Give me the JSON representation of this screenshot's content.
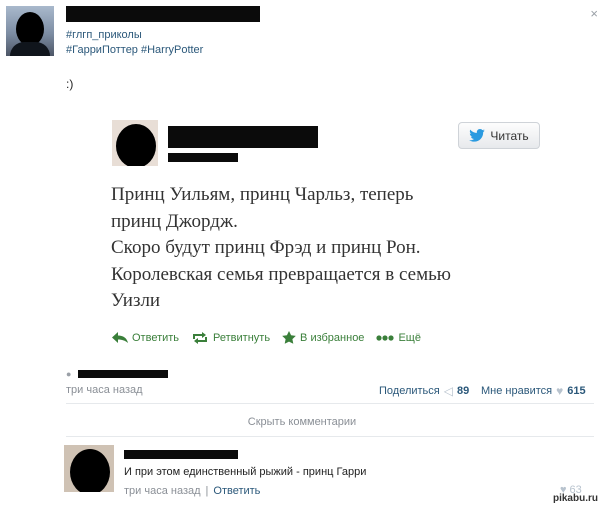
{
  "post": {
    "hashtags_line1": "#глгп_приколы",
    "hashtags_line2": "#ГарриПоттер #HarryPotter",
    "body": ":)",
    "time": "три часа назад",
    "share_label": "Поделиться",
    "share_count": "89",
    "like_label": "Мне нравится",
    "like_count": "615",
    "hide_comments": "Скрыть комментарии"
  },
  "tweet": {
    "follow_label": "Читать",
    "text_lines": [
      "Принц Уильям, принц Чарльз, теперь",
      "принц Джордж.",
      "Скоро будут принц Фрэд и принц Рон.",
      "Королевская семья превращается в семью",
      "Уизли"
    ],
    "actions": {
      "reply": "Ответить",
      "retweet": "Ретвитнуть",
      "favorite": "В избранное",
      "more": "Ещё"
    }
  },
  "comment": {
    "text": "И при этом единственный рыжий - принц Гарри",
    "time": "три часа назад",
    "reply_label": "Ответить",
    "like_count": "63"
  },
  "watermark": "pikabu.ru",
  "colors": {
    "link": "#2b587a",
    "twitter_green": "#3a7f3a",
    "muted": "#8a8f96"
  }
}
